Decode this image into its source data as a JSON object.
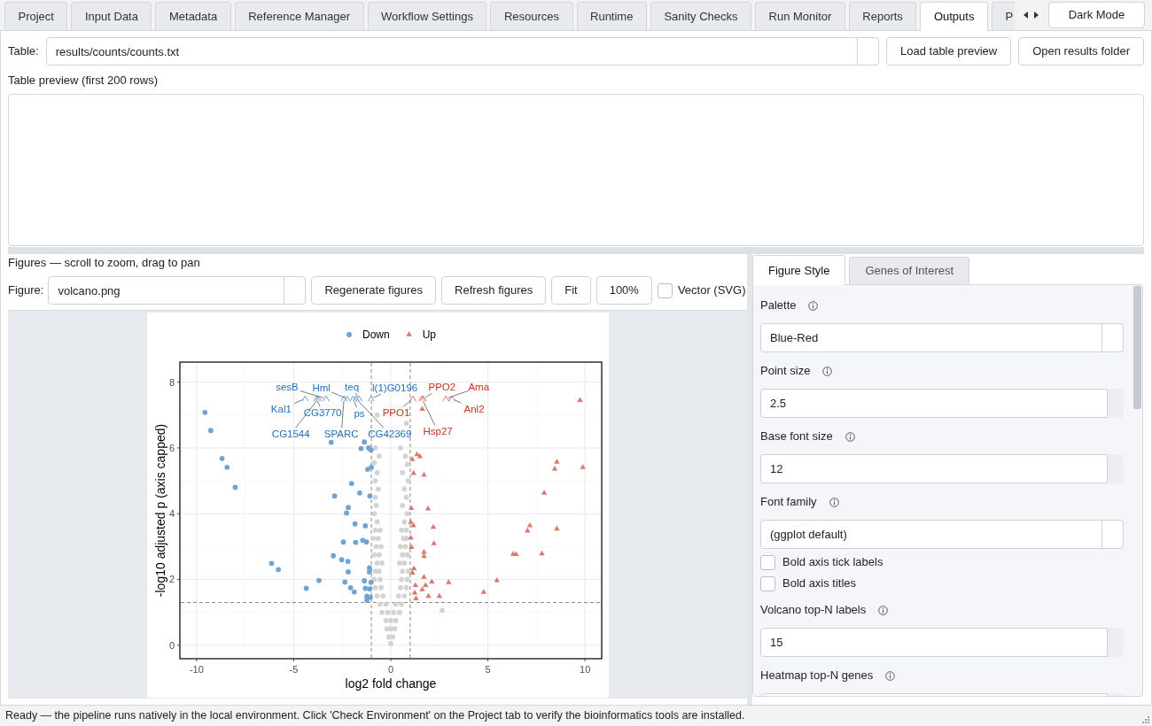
{
  "tabs": [
    {
      "label": "Project",
      "selected": false
    },
    {
      "label": "Input Data",
      "selected": false
    },
    {
      "label": "Metadata",
      "selected": false
    },
    {
      "label": "Reference Manager",
      "selected": false
    },
    {
      "label": "Workflow Settings",
      "selected": false
    },
    {
      "label": "Resources",
      "selected": false
    },
    {
      "label": "Runtime",
      "selected": false
    },
    {
      "label": "Sanity Checks",
      "selected": false
    },
    {
      "label": "Run Monitor",
      "selected": false
    },
    {
      "label": "Reports",
      "selected": false
    },
    {
      "label": "Outputs",
      "selected": true
    },
    {
      "label": "P",
      "selected": false
    }
  ],
  "dark_mode_button": {
    "label": "Dark Mode"
  },
  "table_row": {
    "label": "Table:",
    "value": "results/counts/counts.txt",
    "buttons": [
      "Load table preview",
      "Open results folder"
    ]
  },
  "table_preview": {
    "label": "Table preview (first 200 rows)"
  },
  "figures": {
    "hint": "Figures — scroll to zoom, drag to pan",
    "figure_label": "Figure:",
    "figure_value": "volcano.png",
    "buttons": [
      "Regenerate figures",
      "Refresh figures",
      "Fit",
      "100%"
    ],
    "vector_svg": {
      "label": "Vector (SVG)",
      "checked": false
    },
    "chart_data": {
      "type": "scatter",
      "xlabel": "log2 fold change",
      "ylabel": "-log10 adjusted p (axis capped)",
      "xlim": [
        -10.86,
        10.86
      ],
      "ylim": [
        -0.41,
        8.61
      ],
      "xticks": [
        -10,
        -5,
        0,
        5,
        10
      ],
      "yticks": [
        0,
        2,
        4,
        6,
        8
      ],
      "grid": true,
      "legend": "top",
      "series": [
        {
          "color": "#d3d3d3",
          "x": [
            0,
            -0.1,
            0.1,
            -0.2,
            0,
            0.2,
            -0.25,
            0,
            0.25,
            -0.45,
            -0.15,
            0.15,
            0.45,
            -0.55,
            -0.25,
            0.25,
            0.55,
            -0.7,
            -0.4,
            0.4,
            0.7,
            -0.8,
            -0.5,
            0.5,
            0.8,
            -0.85,
            -0.55,
            0.55,
            0.85,
            -0.8,
            -0.6,
            0.6,
            0.9,
            -0.7,
            -0.45,
            0.45,
            0.7,
            -0.85,
            -0.6,
            0.6,
            0.85,
            -0.75,
            -0.5,
            0.5,
            0.75,
            -0.9,
            -0.65,
            0.65,
            0.8,
            -0.8,
            -0.55,
            0.55,
            0.8,
            -0.7,
            0.7,
            -0.85,
            0.85,
            -0.75,
            0.6,
            -0.8,
            0.8,
            -0.65,
            0.7,
            -0.8,
            0.9,
            -0.7,
            0.6,
            -0.85,
            0.85,
            -0.6,
            0.75,
            -0.8,
            0.5,
            0.8,
            -0.7,
            2.65
          ],
          "values": [
            0.05,
            0.25,
            0.25,
            0.5,
            0.5,
            0.5,
            0.75,
            0.75,
            0.75,
            1,
            1,
            1,
            1,
            1.25,
            1.25,
            1.25,
            1.25,
            1.5,
            1.5,
            1.5,
            1.5,
            1.75,
            1.75,
            1.75,
            1.75,
            2,
            2,
            2,
            2,
            2.25,
            2.25,
            2.25,
            2.25,
            2.5,
            2.5,
            2.5,
            2.5,
            2.75,
            2.75,
            2.75,
            2.75,
            3,
            3,
            3,
            3,
            3.25,
            3.25,
            3.25,
            3.25,
            3.5,
            3.5,
            3.5,
            3.5,
            3.75,
            3.75,
            4,
            4,
            4.25,
            4.25,
            4.5,
            4.5,
            4.75,
            4.75,
            5,
            5,
            5.25,
            5.25,
            5.55,
            5.5,
            5.75,
            5.75,
            6,
            6,
            6.75,
            7.0,
            1.06
          ]
        },
        {
          "name": "Down",
          "color": "#6fa3d3",
          "x": [
            -9.57,
            -9.27,
            -8.69,
            -8.43,
            -8.01,
            -6.14,
            -5.79,
            -4.35,
            -3.7,
            -3.07,
            -2.89,
            -2.96,
            -2.53,
            -2.44,
            -2.36,
            -2.28,
            -2.19,
            -2.21,
            -2.19,
            -2.07,
            -2.02,
            -1.88,
            -1.84,
            -1.81,
            -1.6,
            -1.53,
            -1.36,
            -1.31,
            -1.44,
            -1.25,
            -1.36,
            -1.31,
            -1.19,
            -1.14,
            -1.08,
            -1.1,
            -1.1,
            -1.08,
            -1.23,
            -1.23,
            -1.05,
            -1.02,
            -1.0,
            -1.02,
            -4.41,
            -3.83,
            -3.73,
            -3.33,
            -2.41,
            -2.25,
            -1.94,
            -1.79,
            -1.64,
            -1.02
          ],
          "values": [
            7.08,
            6.53,
            5.68,
            5.41,
            4.8,
            2.49,
            2.3,
            1.73,
            1.97,
            6.17,
            4.54,
            2.72,
            2.6,
            3.14,
            1.92,
            4.02,
            4.19,
            2.55,
            2.23,
            1.75,
            4.92,
            1.62,
            3.69,
            3.13,
            4.63,
            5.98,
            6.18,
            3.63,
            3.19,
            3.14,
            1.96,
            1.73,
            5.35,
            6.0,
            4.54,
            2.35,
            2.23,
            1.71,
            1.49,
            1.37,
            1.46,
            1.91,
            5.41,
            5.94,
            7.5,
            7.5,
            7.5,
            7.5,
            7.5,
            7.5,
            7.5,
            7.5,
            7.5,
            7.5
          ]
        },
        {
          "name": "Up",
          "color": "#d97a6d",
          "x": [
            9.74,
            9.89,
            8.55,
            8.44,
            7.9,
            7.16,
            7.04,
            8.55,
            7.78,
            6.3,
            6.45,
            5.46,
            4.78,
            2.98,
            2.5,
            2.22,
            2.19,
            2.11,
            1.94,
            1.92,
            1.79,
            1.71,
            1.71,
            1.71,
            1.62,
            1.71,
            1.62,
            1.35,
            1.5,
            1.11,
            1.17,
            1.17,
            1.06,
            1.03,
            1.03,
            1.06,
            1.19,
            1.11,
            1.27,
            1.23,
            1.3,
            1.14,
            1.6,
            1.68,
            2.84,
            3.15
          ],
          "values": [
            7.45,
            5.41,
            5.57,
            5.36,
            4.63,
            3.64,
            3.48,
            3.54,
            2.78,
            2.77,
            2.76,
            1.97,
            1.61,
            1.91,
            1.49,
            3.09,
            3.59,
            1.93,
            1.49,
            4.15,
            1.82,
            2.07,
            2.83,
            2.7,
            1.69,
            5.18,
            7.18,
            5.8,
            5.74,
            5.65,
            5.23,
            3.64,
            4.16,
            3.74,
            3.27,
            2.98,
            2.33,
            2.2,
            1.82,
            1.59,
            1.42,
            7.5,
            7.5,
            7.5,
            7.5,
            7.5
          ]
        }
      ],
      "ref_lines": [
        {
          "axis": "x",
          "value": -1
        },
        {
          "axis": "x",
          "value": 1
        },
        {
          "axis": "y",
          "value": 1.3
        }
      ],
      "annotations": [
        {
          "text": "sesB",
          "x": -3.33,
          "y": 7.5
        },
        {
          "text": "Hml",
          "x": -2.25,
          "y": 7.5
        },
        {
          "text": "teq",
          "x": -1.64,
          "y": 7.5
        },
        {
          "text": "l(1)G0196",
          "x": -1.02,
          "y": 7.5
        },
        {
          "text": "PPO2",
          "x": 1.68,
          "y": 7.5
        },
        {
          "text": "Ama",
          "x": 2.84,
          "y": 7.5
        },
        {
          "text": "Kal1",
          "x": -4.41,
          "y": 7.5
        },
        {
          "text": "CG3770",
          "x": -3.83,
          "y": 7.5
        },
        {
          "text": "ps",
          "x": -1.94,
          "y": 7.5
        },
        {
          "text": "PPO1",
          "x": 1.14,
          "y": 7.5
        },
        {
          "text": "Anl2",
          "x": 3.15,
          "y": 7.5
        },
        {
          "text": "CG1544",
          "x": -3.73,
          "y": 7.5
        },
        {
          "text": "SPARC",
          "x": -2.41,
          "y": 7.5
        },
        {
          "text": "CG42369",
          "x": -1.79,
          "y": 7.5
        },
        {
          "text": "Hsp27",
          "x": 1.6,
          "y": 7.5
        }
      ]
    }
  },
  "style_panel": {
    "tabs": [
      {
        "label": "Figure Style",
        "selected": true
      },
      {
        "label": "Genes of Interest",
        "selected": false
      }
    ],
    "fields": [
      {
        "kind": "select",
        "label": "Palette",
        "value": "Blue-Red"
      },
      {
        "kind": "spin",
        "label": "Point size",
        "value": "2.5"
      },
      {
        "kind": "spin",
        "label": "Base font size",
        "value": "12"
      },
      {
        "kind": "select",
        "label": "Font family",
        "value": "(ggplot default)"
      },
      {
        "kind": "checkbox",
        "label": "Bold axis tick labels",
        "checked": false
      },
      {
        "kind": "checkbox",
        "label": "Bold axis titles",
        "checked": false
      },
      {
        "kind": "spin",
        "label": "Volcano top-N labels",
        "value": "15"
      },
      {
        "kind": "spin",
        "label": "Heatmap top-N genes"
      }
    ]
  },
  "status_bar": {
    "text": "Ready — the pipeline runs natively in the local environment. Click 'Check Environment' on the Project tab to verify the bioinformatics tools are installed."
  }
}
